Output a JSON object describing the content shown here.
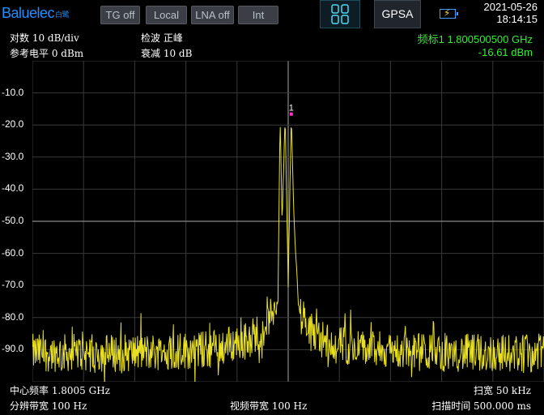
{
  "brand": {
    "name": "Baluelec",
    "cn": "白鹭"
  },
  "toolbar": {
    "tg": "TG off",
    "local": "Local",
    "lna": "LNA off",
    "int": "Int",
    "mode": "GPSA"
  },
  "status": {
    "date": "2021-05-26",
    "time": "18:14:15"
  },
  "settings": {
    "scale": "对数 10 dB/div",
    "ref_level": "参考电平 0 dBm",
    "detector": "检波 正峰",
    "attenuation": "衰减 10 dB"
  },
  "marker": {
    "label": "频标1 1.800500500 GHz",
    "level": "-16.61 dBm",
    "id": "1",
    "color": "#ff33cc"
  },
  "footer": {
    "center_freq": "中心频率 1.8005 GHz",
    "span": "扫宽 50 kHz",
    "rbw": "分辨带宽 100 Hz",
    "vbw": "视频带宽 100 Hz",
    "sweep_time": "扫描时间 500.000 ms"
  },
  "chart_data": {
    "type": "line",
    "title": "",
    "xlabel": "",
    "ylabel": "",
    "y_ticks": [
      "-10.0",
      "-20.0",
      "-30.0",
      "-40.0",
      "-50.0",
      "-60.0",
      "-70.0",
      "-80.0",
      "-90.0"
    ],
    "ylim": [
      -100,
      0
    ],
    "x_span_khz": [
      -25,
      25
    ],
    "grid": true,
    "trace_color": "#e8e020",
    "noise_floor_dbm": -91,
    "series": [
      {
        "values_approx": [
          {
            "x": -25,
            "y": -91
          },
          {
            "x": -15,
            "y": -91
          },
          {
            "x": -8,
            "y": -90
          },
          {
            "x": -4,
            "y": -87
          },
          {
            "x": -2,
            "y": -82
          },
          {
            "x": -1,
            "y": -74
          },
          {
            "x": -0.8,
            "y": -16.6
          },
          {
            "x": -0.6,
            "y": -50
          },
          {
            "x": -0.3,
            "y": -18
          },
          {
            "x": 0,
            "y": -70
          },
          {
            "x": 0.3,
            "y": -16.6
          },
          {
            "x": 0.6,
            "y": -52
          },
          {
            "x": 1,
            "y": -76
          },
          {
            "x": 2,
            "y": -84
          },
          {
            "x": 4,
            "y": -88
          },
          {
            "x": 8,
            "y": -90
          },
          {
            "x": 15,
            "y": -91
          },
          {
            "x": 25,
            "y": -91
          }
        ]
      }
    ]
  }
}
